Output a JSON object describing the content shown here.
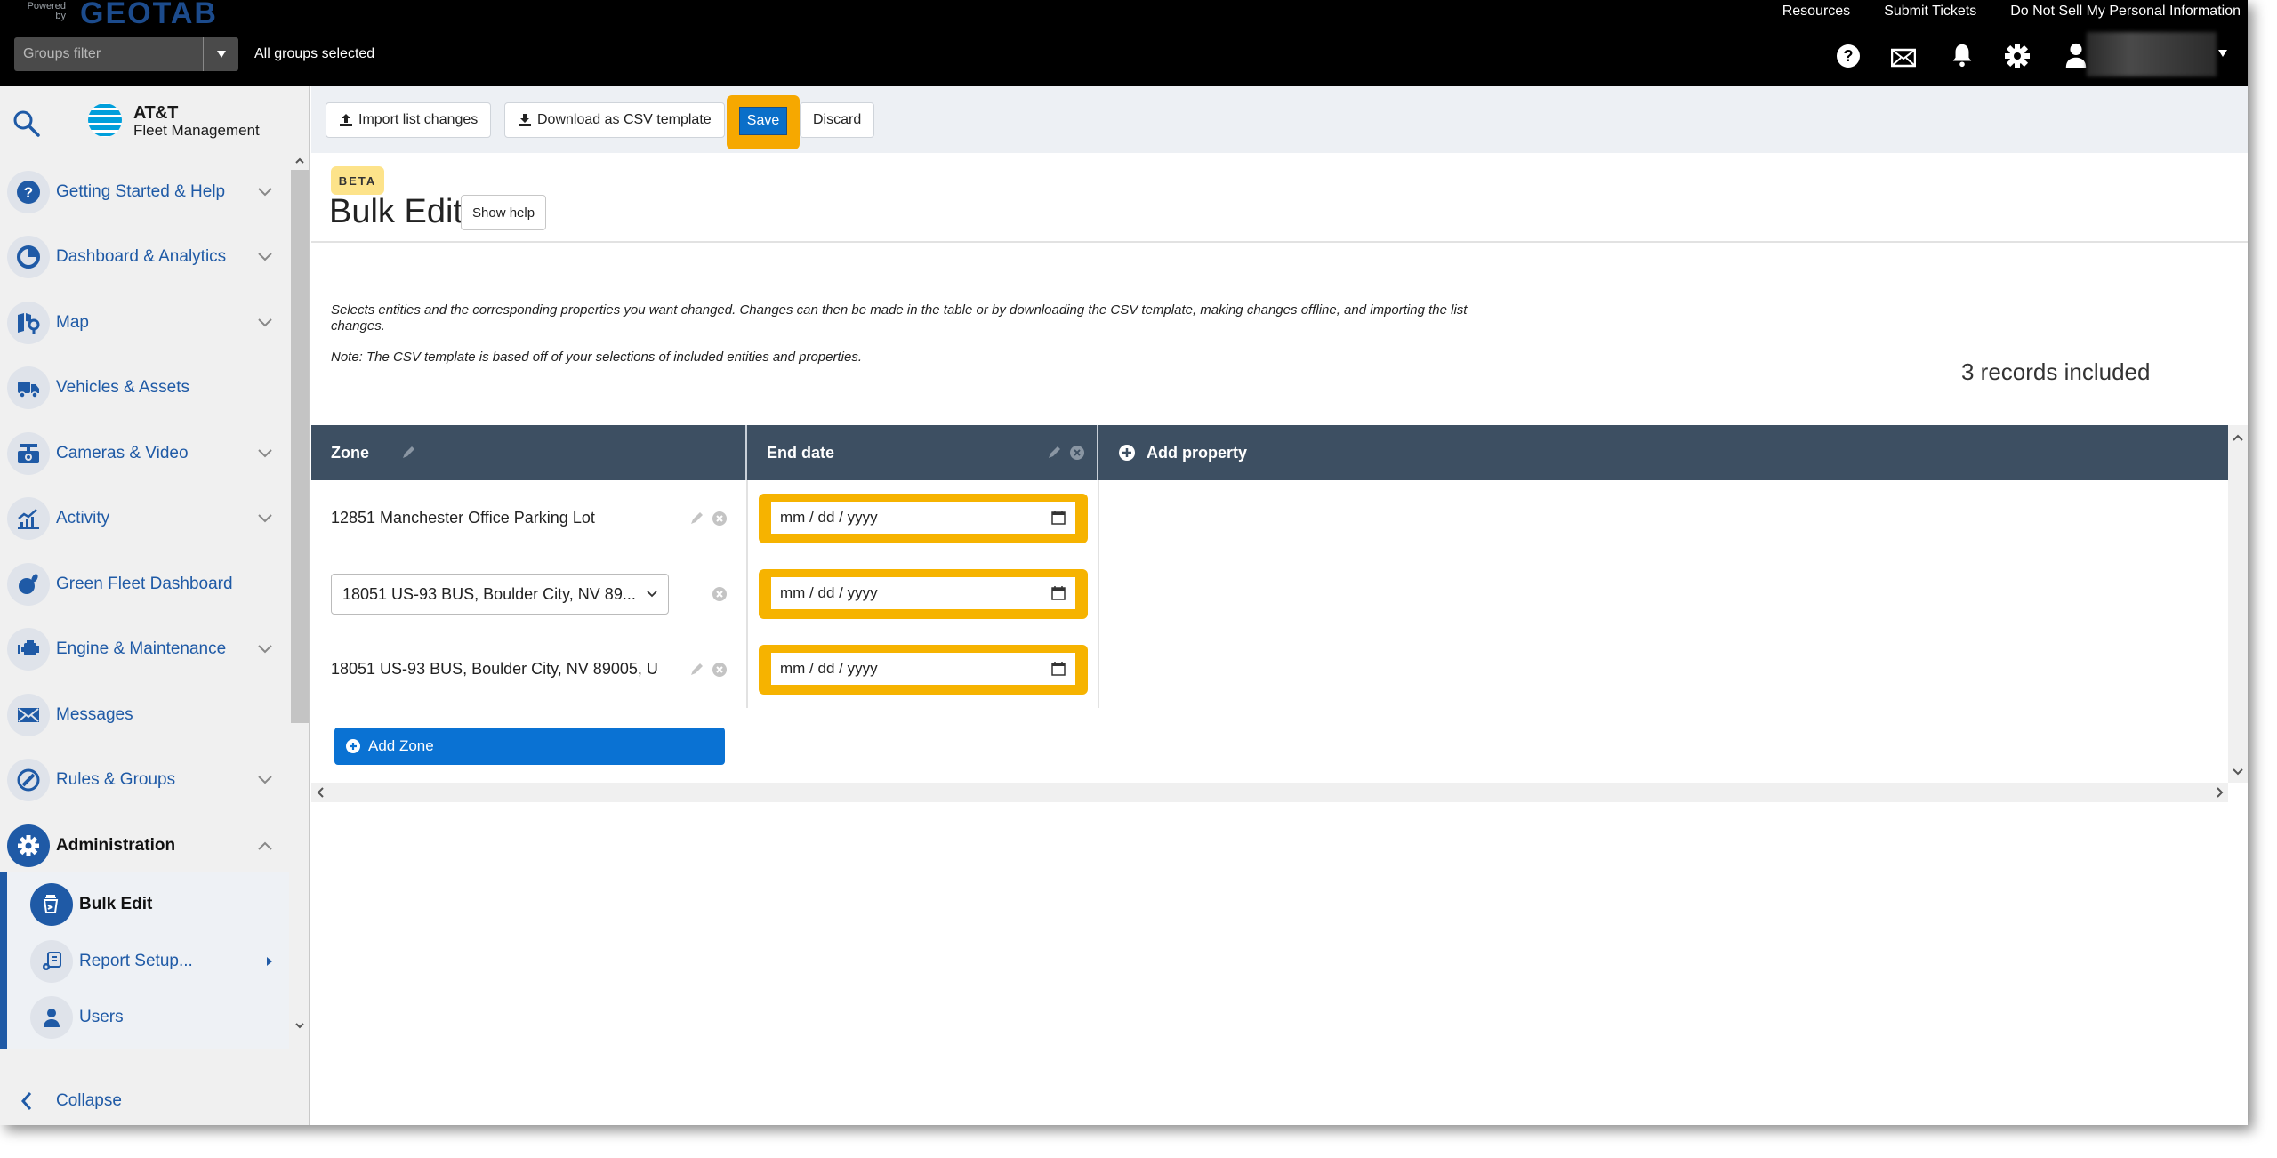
{
  "topbar": {
    "powered_by": "Powered by",
    "brand": "GEOTAB",
    "groups_filter_placeholder": "Groups filter",
    "groups_status": "All groups selected",
    "links": [
      "Resources",
      "Submit Tickets",
      "Do Not Sell My Personal Information"
    ],
    "icons": [
      "help-icon",
      "mail-icon",
      "bell-icon",
      "gear-icon",
      "user-icon"
    ]
  },
  "sidebar": {
    "logo_line1": "AT&T",
    "logo_line2": "Fleet Management",
    "items": [
      {
        "label": "Getting Started & Help",
        "icon": "help-circle-icon",
        "expandable": true
      },
      {
        "label": "Dashboard & Analytics",
        "icon": "pie-chart-icon",
        "expandable": true
      },
      {
        "label": "Map",
        "icon": "map-icon",
        "expandable": true
      },
      {
        "label": "Vehicles & Assets",
        "icon": "truck-icon",
        "expandable": false
      },
      {
        "label": "Cameras & Video",
        "icon": "camera-icon",
        "expandable": true
      },
      {
        "label": "Activity",
        "icon": "activity-chart-icon",
        "expandable": true
      },
      {
        "label": "Green Fleet Dashboard",
        "icon": "leaf-icon",
        "expandable": false
      },
      {
        "label": "Engine & Maintenance",
        "icon": "engine-icon",
        "expandable": true
      },
      {
        "label": "Messages",
        "icon": "envelope-icon",
        "expandable": false
      },
      {
        "label": "Rules & Groups",
        "icon": "rules-icon",
        "expandable": true
      },
      {
        "label": "Administration",
        "icon": "gear-icon",
        "expandable": true,
        "expanded": true
      }
    ],
    "sub_items": [
      {
        "label": "Bulk Edit",
        "active": true
      },
      {
        "label": "Report Setup...",
        "has_submenu": true
      },
      {
        "label": "Users"
      }
    ],
    "collapse_label": "Collapse"
  },
  "toolbar": {
    "import_label": "Import list changes",
    "download_label": "Download as CSV template",
    "save_label": "Save",
    "discard_label": "Discard"
  },
  "page": {
    "badge": "BETA",
    "title": "Bulk Edit",
    "show_help_label": "Show help",
    "description": "Selects entities and the corresponding properties you want changed. Changes can then be made in the table or by downloading the CSV template, making changes offline, and importing the list changes.",
    "note": "Note: The CSV template is based off of your selections of included entities and properties.",
    "records_included": "3 records included"
  },
  "table": {
    "columns": [
      "Zone",
      "End date"
    ],
    "add_property_label": "Add property",
    "rows": [
      {
        "zone": "12851 Manchester Office Parking Lot",
        "zone_mode": "text",
        "end_date_placeholder": "mm / dd / yyyy"
      },
      {
        "zone": "18051 US-93 BUS, Boulder City, NV 89...",
        "zone_mode": "select",
        "end_date_placeholder": "mm / dd / yyyy"
      },
      {
        "zone": "18051 US-93 BUS, Boulder City, NV 89005, U",
        "zone_mode": "text",
        "end_date_placeholder": "mm / dd / yyyy"
      }
    ],
    "add_zone_label": "Add Zone"
  },
  "colors": {
    "accent_blue": "#1f5aa6",
    "save_blue": "#0a6fc9",
    "highlight_orange": "#f6a800",
    "table_header": "#3d4f62",
    "beta_yellow": "#fde38a"
  }
}
